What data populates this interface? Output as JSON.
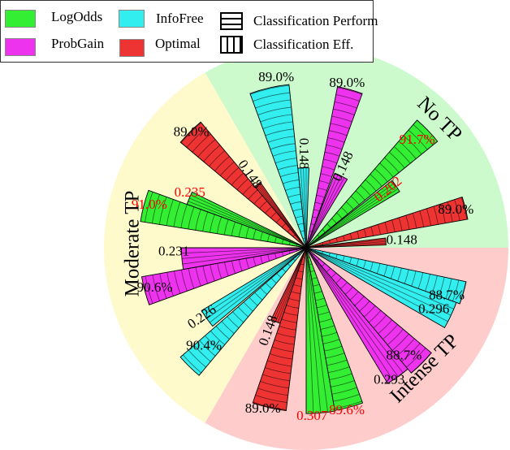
{
  "chart_data": {
    "type": "polar-bar",
    "title": "",
    "legend": {
      "placement": "top-left",
      "methods": [
        {
          "name": "LogOdds",
          "color": "#33ee33"
        },
        {
          "name": "ProbGain",
          "color": "#ee33ee"
        },
        {
          "name": "InfoFree",
          "color": "#33eeee"
        },
        {
          "name": "Optimal",
          "color": "#ee3333"
        }
      ],
      "metrics": [
        {
          "name": "Classification Perform",
          "hatch": "horizontal"
        },
        {
          "name": "Classification Eff.",
          "hatch": "vertical"
        }
      ]
    },
    "sectors": [
      {
        "name": "No TP",
        "background": "#ccfacc",
        "bars": [
          {
            "method": "Optimal",
            "metric": "eff",
            "value": 0.148,
            "label": "0.148",
            "highlight": false
          },
          {
            "method": "Optimal",
            "metric": "perf",
            "value": 89.0,
            "label": "89.0%",
            "highlight": false
          },
          {
            "method": "LogOdds",
            "metric": "eff",
            "value": 0.202,
            "label": "0.202",
            "highlight": true
          },
          {
            "method": "LogOdds",
            "metric": "perf",
            "value": 91.7,
            "label": "91.7%",
            "highlight": true
          },
          {
            "method": "ProbGain",
            "metric": "eff",
            "value": 0.148,
            "label": "0.148",
            "highlight": false
          },
          {
            "method": "ProbGain",
            "metric": "perf",
            "value": 89.0,
            "label": "89.0%",
            "highlight": false
          },
          {
            "method": "InfoFree",
            "metric": "eff",
            "value": 0.148,
            "label": "0.148",
            "highlight": false
          },
          {
            "method": "InfoFree",
            "metric": "perf",
            "value": 89.0,
            "label": "89.0%",
            "highlight": false
          }
        ]
      },
      {
        "name": "Moderate TP",
        "background": "#fefacc",
        "bars": [
          {
            "method": "Optimal",
            "metric": "eff",
            "value": 0.148,
            "label": "0.148",
            "highlight": false
          },
          {
            "method": "Optimal",
            "metric": "perf",
            "value": 89.0,
            "label": "89.0%",
            "highlight": false
          },
          {
            "method": "LogOdds",
            "metric": "eff",
            "value": 0.235,
            "label": "0.235",
            "highlight": true
          },
          {
            "method": "LogOdds",
            "metric": "perf",
            "value": 91.0,
            "label": "91.0%",
            "highlight": true
          },
          {
            "method": "ProbGain",
            "metric": "eff",
            "value": 0.231,
            "label": "0.231",
            "highlight": false
          },
          {
            "method": "ProbGain",
            "metric": "perf",
            "value": 90.6,
            "label": "90.6%",
            "highlight": false
          },
          {
            "method": "InfoFree",
            "metric": "eff",
            "value": 0.226,
            "label": "0.226",
            "highlight": false
          },
          {
            "method": "InfoFree",
            "metric": "perf",
            "value": 90.4,
            "label": "90.4%",
            "highlight": false
          }
        ]
      },
      {
        "name": "Intense TP",
        "background": "#ffcccc",
        "bars": [
          {
            "method": "Optimal",
            "metric": "eff",
            "value": 0.148,
            "label": "0.148",
            "highlight": false
          },
          {
            "method": "Optimal",
            "metric": "perf",
            "value": 89.0,
            "label": "89.0%",
            "highlight": false
          },
          {
            "method": "LogOdds",
            "metric": "eff",
            "value": 0.307,
            "label": "0.307",
            "highlight": true
          },
          {
            "method": "LogOdds",
            "metric": "perf",
            "value": 89.6,
            "label": "89.6%",
            "highlight": true
          },
          {
            "method": "ProbGain",
            "metric": "eff",
            "value": 0.293,
            "label": "0.293",
            "highlight": false
          },
          {
            "method": "ProbGain",
            "metric": "perf",
            "value": 88.7,
            "label": "88.7%",
            "highlight": false
          },
          {
            "method": "InfoFree",
            "metric": "eff",
            "value": 0.296,
            "label": "0.296",
            "highlight": false
          },
          {
            "method": "InfoFree",
            "metric": "perf",
            "value": 88.7,
            "label": "88.7%",
            "highlight": false
          }
        ]
      }
    ],
    "highlight_color": "#ff0000",
    "text_color": "#000000"
  }
}
